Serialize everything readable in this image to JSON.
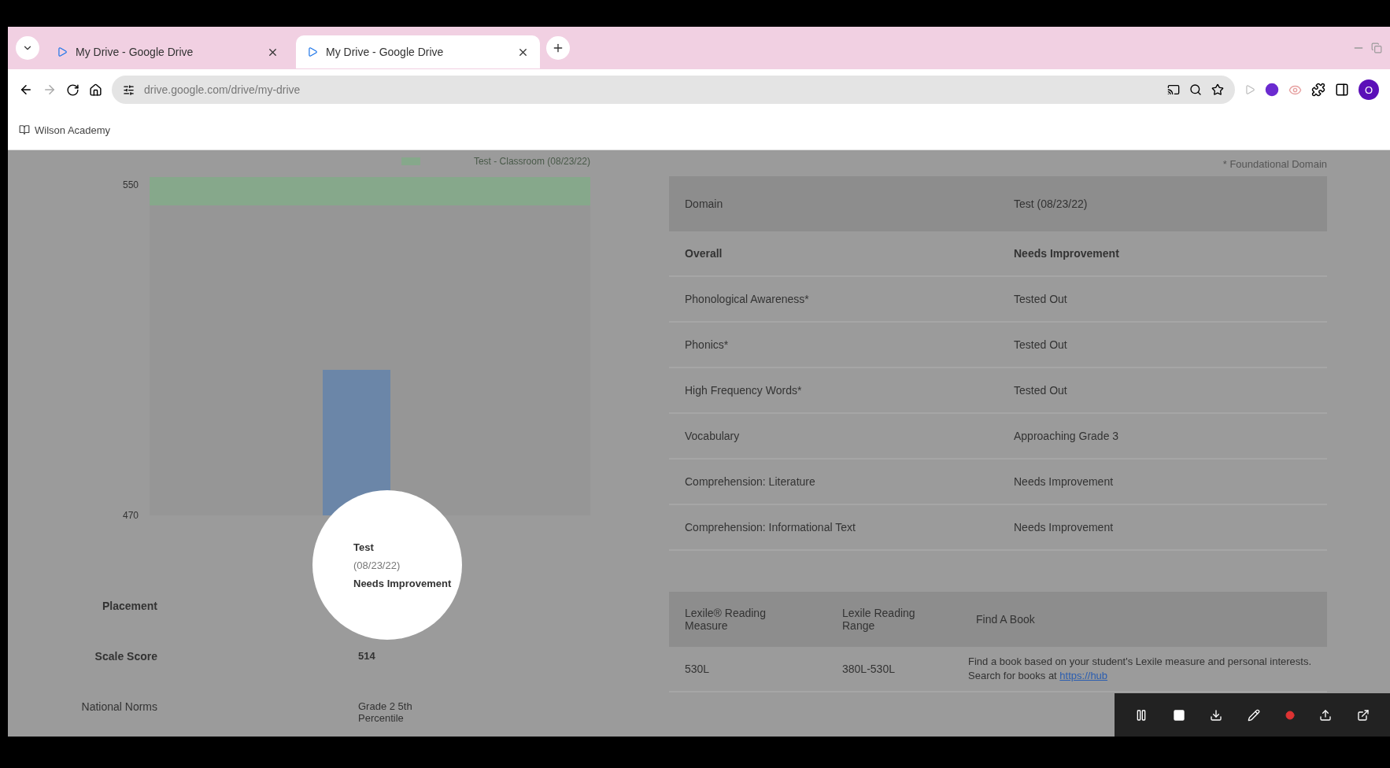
{
  "browser": {
    "tabs": [
      {
        "title": "My Drive - Google Drive",
        "selected": false
      },
      {
        "title": "My Drive - Google Drive",
        "selected": true
      }
    ],
    "url": "drive.google.com/drive/my-drive",
    "profile_initial": "O",
    "bookmarks": [
      "Wilson Academy"
    ]
  },
  "chart": {
    "legend": "Test - Classroom (08/23/22)",
    "axis_labels": [
      "550",
      "470"
    ]
  },
  "results": {
    "column_header": [
      "Test",
      "(08/23/22)"
    ],
    "rows": [
      {
        "label": "Placement",
        "value": "Needs Improvement"
      },
      {
        "label": "Scale Score",
        "value": "514"
      },
      {
        "label": "National Norms",
        "value": "Grade 2 5th Percentile"
      }
    ]
  },
  "domain_table": {
    "note": "* Foundational Domain",
    "columns": [
      "Domain",
      "Test (08/23/22)"
    ],
    "rows": [
      {
        "domain": "Overall",
        "result": "Needs Improvement",
        "bold": true
      },
      {
        "domain": "Phonological Awareness*",
        "result": "Tested Out",
        "bold": false
      },
      {
        "domain": "Phonics*",
        "result": "Tested Out",
        "bold": false
      },
      {
        "domain": "High Frequency Words*",
        "result": "Tested Out",
        "bold": false
      },
      {
        "domain": "Vocabulary",
        "result": "Approaching Grade 3",
        "bold": false
      },
      {
        "domain": "Comprehension: Literature",
        "result": "Needs Improvement",
        "bold": false
      },
      {
        "domain": "Comprehension: Informational Text",
        "result": "Needs Improvement",
        "bold": false
      }
    ]
  },
  "lexile_table": {
    "columns": [
      "Lexile® Reading Measure",
      "Lexile Reading Range",
      "Find A Book"
    ],
    "row": {
      "measure": "530L",
      "range": "380L-530L",
      "text": "Find a book based on your student's Lexile measure and personal interests. Search for books at",
      "link": "https://hub"
    }
  }
}
